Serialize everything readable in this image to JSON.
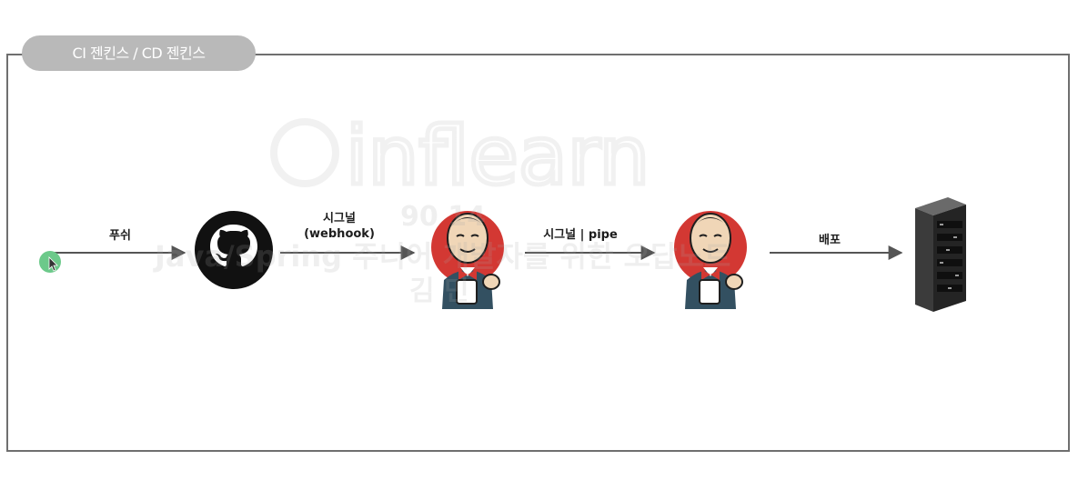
{
  "diagram": {
    "section_title": "CI 젠킨스 / CD 젠킨스",
    "edges": [
      {
        "id": "push",
        "label": "푸쉬"
      },
      {
        "id": "webhook",
        "label_line1": "시그널",
        "label_line2": "(webhook)"
      },
      {
        "id": "pipe",
        "label": "시그널 | pipe"
      },
      {
        "id": "deploy",
        "label": "배포"
      }
    ],
    "nodes": [
      {
        "id": "github",
        "icon": "github-icon"
      },
      {
        "id": "jenkins-ci",
        "icon": "jenkins-icon"
      },
      {
        "id": "jenkins-cd",
        "icon": "jenkins-icon"
      },
      {
        "id": "server",
        "icon": "server-rack-icon"
      }
    ],
    "colors": {
      "frame": "#6f6f6f",
      "tab": "#b9b9b9",
      "arrow": "#555555",
      "jenkins_red": "#d33833",
      "cursor_dot": "#6cc98a"
    }
  },
  "watermark": {
    "brand": "inflearn",
    "line1": "90 14",
    "line2": "Java/Spring 주니어 개발자를 위한 오답노트",
    "line3": "김 민"
  }
}
